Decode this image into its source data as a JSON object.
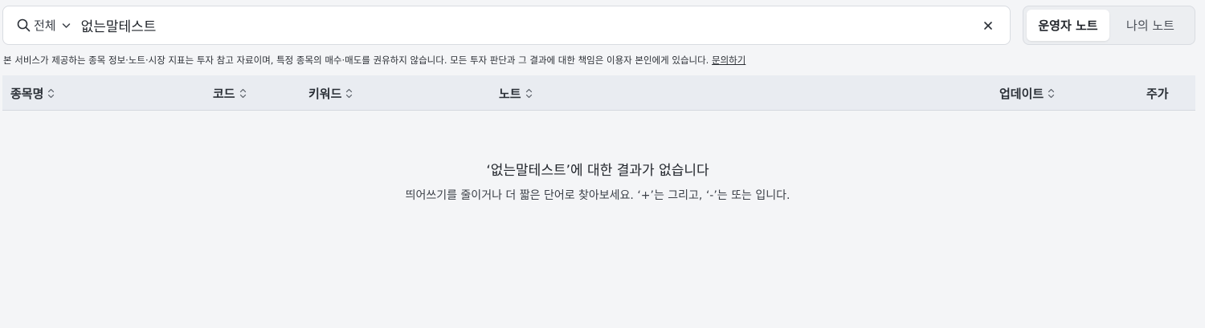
{
  "search": {
    "scope_label": "전체",
    "query": "없는말테스트",
    "icons": {
      "search": "search-icon",
      "scope": "chevron-down-icon",
      "clear": "close-icon"
    }
  },
  "note_toggle": {
    "operator_label": "운영자 노트",
    "mine_label": "나의 노트",
    "selected": "운영자 노트"
  },
  "disclaimer": {
    "text": "본 서비스가 제공하는 종목 정보·노트·시장 지표는 투자 참고 자료이며, 특정 종목의 매수·매도를 권유하지 않습니다. 모든 투자 판단과 그 결과에 대한 책임은 이용자 본인에게 있습니다. ",
    "link_label": "문의하기"
  },
  "table": {
    "columns": {
      "name": "종목명",
      "code": "코드",
      "keyword": "키워드",
      "note": "노트",
      "updated": "업데이트",
      "price": "주가"
    },
    "sort_icon": "sort-updown-icon"
  },
  "empty_state": {
    "title": "‘없는말테스트’에 대한 결과가 없습니다",
    "hint": "띄어쓰기를 줄이거나 더 짧은 단어로 찾아보세요. ‘+’는 그리고, ‘-’는 또는 입니다."
  },
  "colors": {
    "page_bg": "#f4f5f7",
    "header_bg": "#e9ecf1",
    "border": "#d9dce1",
    "text": "#1f2329"
  }
}
